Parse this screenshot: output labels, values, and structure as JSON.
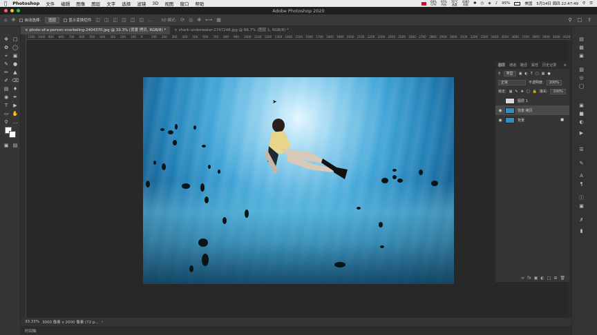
{
  "menubar": {
    "app_name": "Photoshop",
    "items": [
      "文件",
      "编辑",
      "图像",
      "图层",
      "文字",
      "选择",
      "滤镜",
      "3D",
      "视图",
      "窗口",
      "帮助"
    ],
    "stats": [
      {
        "top": "69%",
        "bottom": "CPU"
      },
      {
        "top": "65%",
        "bottom": "内存"
      },
      {
        "top": "76°C",
        "bottom": "温度"
      },
      {
        "top": "4380",
        "bottom": "风扇"
      }
    ],
    "battery": "95%",
    "locale": "美国",
    "datetime": "5月14日 周四 22:47:49"
  },
  "window": {
    "title": "Adobe Photoshop 2020"
  },
  "options_bar": {
    "auto_select_label": "自动选择:",
    "auto_select_value": "图层",
    "show_transform_label": "显示变换控件",
    "mode_3d_label": "3D 模式:"
  },
  "tabs": [
    {
      "label": "photo-of-a-person-snorkeling-2404370.jpg @ 33.3% (背景 拷贝, RGB/8) *",
      "active": true
    },
    {
      "label": "shark-underwater-2747248.jpg @ 66.7% (图层 1, RGB/8) *",
      "active": false
    }
  ],
  "ruler": {
    "ticks": [
      "1500",
      "1000",
      "900",
      "800",
      "700",
      "600",
      "500",
      "400",
      "300",
      "200",
      "100",
      "0",
      "100",
      "200",
      "300",
      "400",
      "500",
      "600",
      "700",
      "800",
      "900",
      "1000",
      "1100",
      "1200",
      "1300",
      "1400",
      "1500",
      "1600",
      "1700",
      "1800",
      "1900",
      "2000",
      "2100",
      "2200",
      "2300",
      "2400",
      "2500",
      "2600",
      "2700",
      "2800",
      "2900",
      "3000",
      "3100",
      "3200",
      "3300",
      "3400",
      "3500",
      "3600",
      "3700",
      "3800",
      "3900",
      "4000",
      "4100",
      "4200",
      "4300"
    ]
  },
  "layers_panel": {
    "tabs": [
      "图层",
      "通道",
      "路径",
      "属性",
      "历史记录"
    ],
    "kind_label": "类型",
    "blend_mode": "正常",
    "opacity_label": "不透明度:",
    "opacity_value": "100%",
    "lock_label": "锁定:",
    "fill_label": "填充:",
    "fill_value": "100%",
    "layers": [
      {
        "name": "图层 1",
        "visible": false,
        "selected": false,
        "thumb": "#d9d9d9"
      },
      {
        "name": "背景 拷贝",
        "visible": true,
        "selected": true,
        "thumb": "#2e8fc4"
      },
      {
        "name": "背景",
        "visible": true,
        "selected": false,
        "thumb": "#2e8fc4",
        "locked": true
      }
    ]
  },
  "status": {
    "zoom": "33.33%",
    "doc_info": "3000 像素 x 2000 像素 (72 p...",
    "timeline_label": "时间轴"
  },
  "colors": {
    "accent": "#2e8fc4",
    "menubar": "#e9e9e9",
    "workspace": "#282828"
  }
}
